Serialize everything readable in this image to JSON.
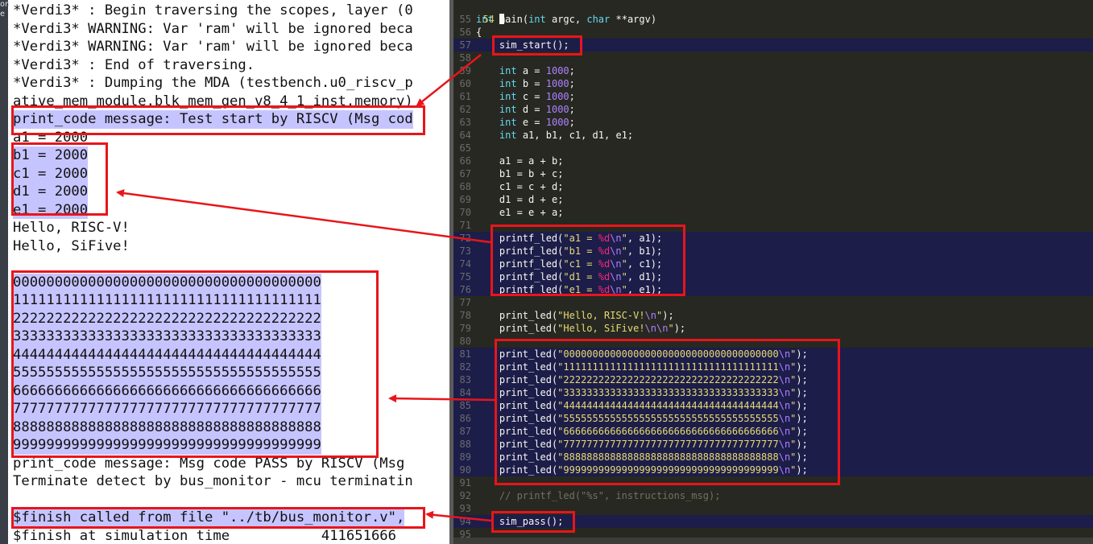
{
  "sidebar_fragment": [
    "on",
    "e"
  ],
  "terminal": {
    "lines": [
      "*Verdi3* : Begin traversing the scopes, layer (0",
      "*Verdi3* WARNING: Var 'ram' will be ignored beca",
      "*Verdi3* WARNING: Var 'ram' will be ignored beca",
      "*Verdi3* : End of traversing.",
      "*Verdi3* : Dumping the MDA (testbench.u0_riscv_p",
      "ative_mem_module.blk_mem_gen_v8_4_1_inst.memory)",
      "print_code message: Test start by RISCV (Msg cod",
      "a1 = 2000",
      "b1 = 2000",
      "c1 = 2000",
      "d1 = 2000",
      "e1 = 2000",
      "Hello, RISC-V!",
      "Hello, SiFive!",
      "",
      "0000000000000000000000000000000000000",
      "1111111111111111111111111111111111111",
      "2222222222222222222222222222222222222",
      "3333333333333333333333333333333333333",
      "4444444444444444444444444444444444444",
      "5555555555555555555555555555555555555",
      "6666666666666666666666666666666666666",
      "7777777777777777777777777777777777777",
      "8888888888888888888888888888888888888",
      "9999999999999999999999999999999999999",
      "print_code message: Msg code PASS by RISCV (Msg",
      "Terminate detect by bus_monitor - mcu terminatin",
      "",
      "$finish called from file \"../tb/bus_monitor.v\",",
      "$finish at simulation time           411651666"
    ]
  },
  "editor": {
    "current_line_number": "54",
    "lines": [
      {
        "n": "55",
        "code": "int main(int argc, char **argv)"
      },
      {
        "n": "56",
        "code": "{"
      },
      {
        "n": "57",
        "code": "    sim_start();"
      },
      {
        "n": "58",
        "code": ""
      },
      {
        "n": "59",
        "code": "    int a = 1000;"
      },
      {
        "n": "60",
        "code": "    int b = 1000;"
      },
      {
        "n": "61",
        "code": "    int c = 1000;"
      },
      {
        "n": "62",
        "code": "    int d = 1000;"
      },
      {
        "n": "63",
        "code": "    int e = 1000;"
      },
      {
        "n": "64",
        "code": "    int a1, b1, c1, d1, e1;"
      },
      {
        "n": "65",
        "code": ""
      },
      {
        "n": "66",
        "code": "    a1 = a + b;"
      },
      {
        "n": "67",
        "code": "    b1 = b + c;"
      },
      {
        "n": "68",
        "code": "    c1 = c + d;"
      },
      {
        "n": "69",
        "code": "    d1 = d + e;"
      },
      {
        "n": "70",
        "code": "    e1 = e + a;"
      },
      {
        "n": "71",
        "code": ""
      },
      {
        "n": "72",
        "code": "    printf_led(\"a1 = %d\\n\", a1);"
      },
      {
        "n": "73",
        "code": "    printf_led(\"b1 = %d\\n\", b1);"
      },
      {
        "n": "74",
        "code": "    printf_led(\"c1 = %d\\n\", c1);"
      },
      {
        "n": "75",
        "code": "    printf_led(\"d1 = %d\\n\", d1);"
      },
      {
        "n": "76",
        "code": "    printf_led(\"e1 = %d\\n\", e1);"
      },
      {
        "n": "77",
        "code": ""
      },
      {
        "n": "78",
        "code": "    print_led(\"Hello, RISC-V!\\n\");"
      },
      {
        "n": "79",
        "code": "    print_led(\"Hello, SiFive!\\n\\n\");"
      },
      {
        "n": "80",
        "code": ""
      },
      {
        "n": "81",
        "code": "    print_led(\"0000000000000000000000000000000000000\\n\");"
      },
      {
        "n": "82",
        "code": "    print_led(\"1111111111111111111111111111111111111\\n\");"
      },
      {
        "n": "83",
        "code": "    print_led(\"2222222222222222222222222222222222222\\n\");"
      },
      {
        "n": "84",
        "code": "    print_led(\"3333333333333333333333333333333333333\\n\");"
      },
      {
        "n": "85",
        "code": "    print_led(\"4444444444444444444444444444444444444\\n\");"
      },
      {
        "n": "86",
        "code": "    print_led(\"5555555555555555555555555555555555555\\n\");"
      },
      {
        "n": "87",
        "code": "    print_led(\"6666666666666666666666666666666666666\\n\");"
      },
      {
        "n": "88",
        "code": "    print_led(\"7777777777777777777777777777777777777\\n\");"
      },
      {
        "n": "89",
        "code": "    print_led(\"8888888888888888888888888888888888888\\n\");"
      },
      {
        "n": "90",
        "code": "    print_led(\"9999999999999999999999999999999999999\\n\");"
      },
      {
        "n": "91",
        "code": ""
      },
      {
        "n": "92",
        "code": "    // printf_led(\"%s\", instructions_msg);"
      },
      {
        "n": "93",
        "code": ""
      },
      {
        "n": "94",
        "code": "    sim_pass();"
      },
      {
        "n": "95",
        "code": ""
      }
    ]
  },
  "colors": {
    "editor_bg": "#272822",
    "highlight": "#c6c4ff",
    "annotation_red": "#e8151b"
  }
}
